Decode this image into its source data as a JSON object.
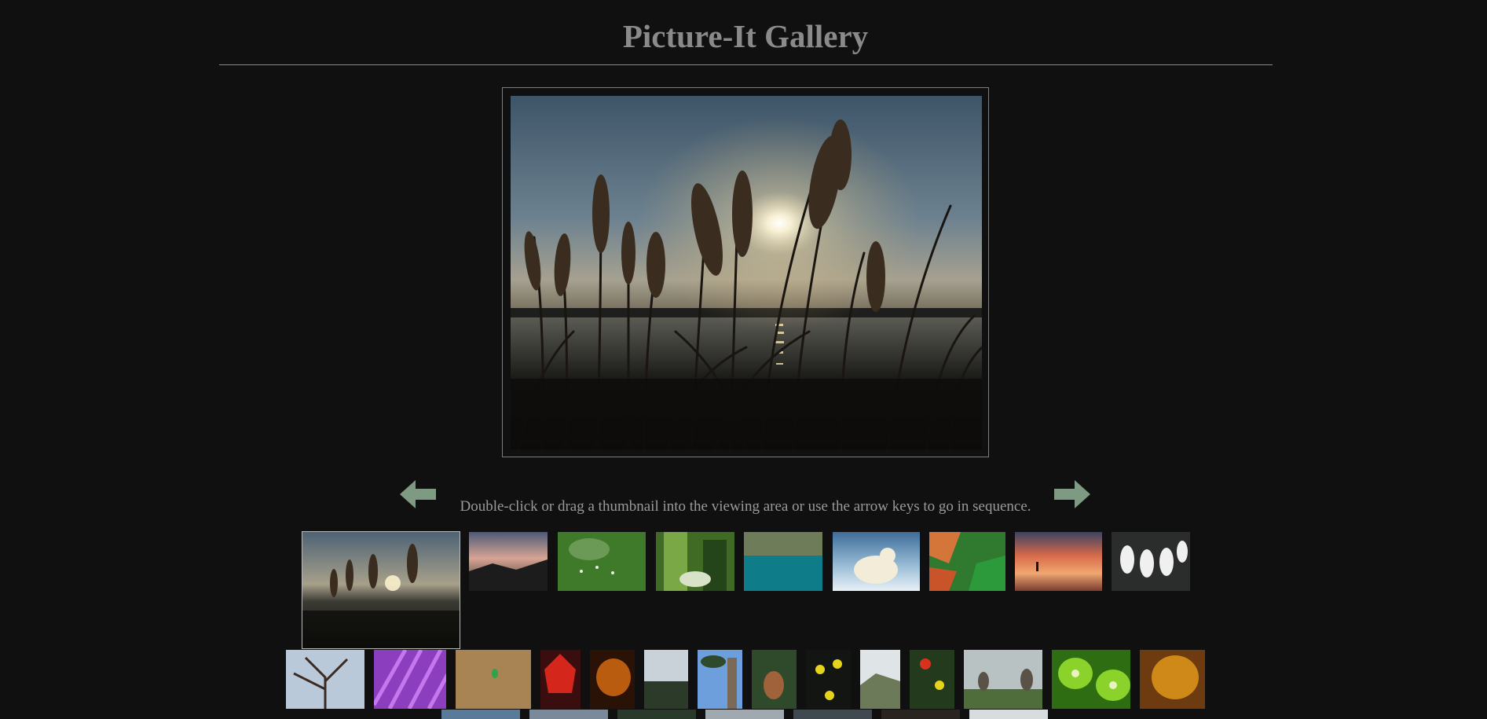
{
  "gallery": {
    "title": "Picture-It Gallery",
    "instructions": "Double-click or drag a thumbnail into the viewing area or use the arrow keys to go in sequence.",
    "colors": {
      "background": "#101010",
      "title": "#8a8a8a",
      "arrow": "#7f9a82"
    }
  },
  "viewer": {
    "image": "pampas-grass-sunset"
  },
  "navigation": {
    "previous_icon": "arrow-left-icon",
    "next_icon": "arrow-right-icon"
  },
  "thumbnails": {
    "row1": [
      {
        "name": "thumb-pampas-grass-sunset",
        "active": true
      },
      {
        "name": "thumb-mountain-dusk"
      },
      {
        "name": "thumb-green-field-birds"
      },
      {
        "name": "thumb-forest-stream"
      },
      {
        "name": "thumb-teal-lake"
      },
      {
        "name": "thumb-polar-bear"
      },
      {
        "name": "thumb-green-orange-tiles"
      },
      {
        "name": "thumb-beach-sunset"
      },
      {
        "name": "thumb-white-swans"
      }
    ],
    "row2": [
      {
        "name": "thumb-blossom-tree"
      },
      {
        "name": "thumb-lavender-field"
      },
      {
        "name": "thumb-burlap-bug"
      },
      {
        "name": "thumb-red-maple-leaves"
      },
      {
        "name": "thumb-autumn-glow"
      },
      {
        "name": "thumb-misty-trees"
      },
      {
        "name": "thumb-palm-tree"
      },
      {
        "name": "thumb-fawn"
      },
      {
        "name": "thumb-yellow-flowers"
      },
      {
        "name": "thumb-hill-valley"
      },
      {
        "name": "thumb-red-tulip"
      },
      {
        "name": "thumb-geese"
      },
      {
        "name": "thumb-kiwi-slices"
      },
      {
        "name": "thumb-golden-leaves"
      }
    ],
    "row3_partial": 7
  }
}
